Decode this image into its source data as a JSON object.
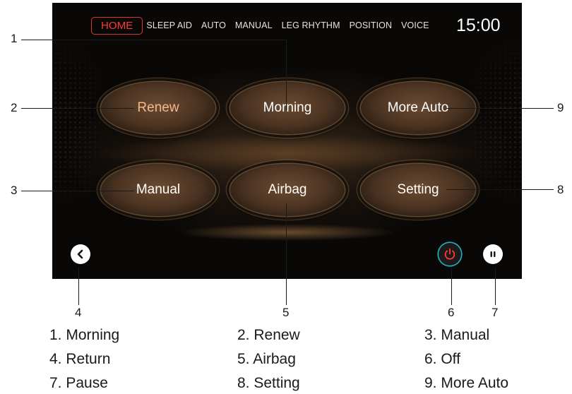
{
  "nav": {
    "items": [
      "HOME",
      "SLEEP AID",
      "AUTO",
      "MANUAL",
      "LEG RHYTHM",
      "POSITION",
      "VOICE"
    ],
    "active_item": "HOME",
    "clock": "15:00"
  },
  "buttons": {
    "renew": "Renew",
    "morning": "Morning",
    "more_auto": "More Auto",
    "manual": "Manual",
    "airbag": "Airbag",
    "setting": "Setting"
  },
  "icons": {
    "back": "chevron-left-icon",
    "power": "power-icon",
    "pause": "pause-icon"
  },
  "colors": {
    "active_nav": "#ff3b30",
    "highlight_label": "#f3b98c",
    "power_ring": "#1ab5c4",
    "power_icon": "#ff3b30"
  },
  "callouts": [
    "1",
    "2",
    "3",
    "4",
    "5",
    "6",
    "7",
    "8",
    "9"
  ],
  "legend": [
    "1. Morning",
    "2. Renew",
    "3. Manual",
    "4. Return",
    "5. Airbag",
    "6. Off",
    "7. Pause",
    "8. Setting",
    "9. More Auto"
  ]
}
